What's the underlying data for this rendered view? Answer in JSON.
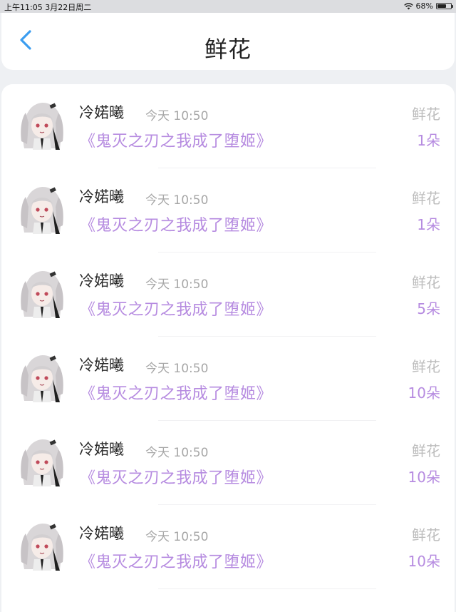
{
  "status_bar": {
    "time_date": "上午11:05   3月22日周二",
    "battery": "68%",
    "battery_level": 0.68
  },
  "nav": {
    "title": "鲜花",
    "back_icon": "chevron-left-icon"
  },
  "colors": {
    "accent_blue": "#3b9df0",
    "accent_purple": "#b68be0",
    "muted_gray": "#a7a7a7"
  },
  "records": [
    {
      "name": "冷婼曦",
      "time": "今天 10:50",
      "book": "《鬼灭之刃之我成了堕姬》",
      "gift": "鲜花",
      "count": "1朵"
    },
    {
      "name": "冷婼曦",
      "time": "今天 10:50",
      "book": "《鬼灭之刃之我成了堕姬》",
      "gift": "鲜花",
      "count": "1朵"
    },
    {
      "name": "冷婼曦",
      "time": "今天 10:50",
      "book": "《鬼灭之刃之我成了堕姬》",
      "gift": "鲜花",
      "count": "5朵"
    },
    {
      "name": "冷婼曦",
      "time": "今天 10:50",
      "book": "《鬼灭之刃之我成了堕姬》",
      "gift": "鲜花",
      "count": "10朵"
    },
    {
      "name": "冷婼曦",
      "time": "今天 10:50",
      "book": "《鬼灭之刃之我成了堕姬》",
      "gift": "鲜花",
      "count": "10朵"
    },
    {
      "name": "冷婼曦",
      "time": "今天 10:50",
      "book": "《鬼灭之刃之我成了堕姬》",
      "gift": "鲜花",
      "count": "10朵"
    }
  ]
}
